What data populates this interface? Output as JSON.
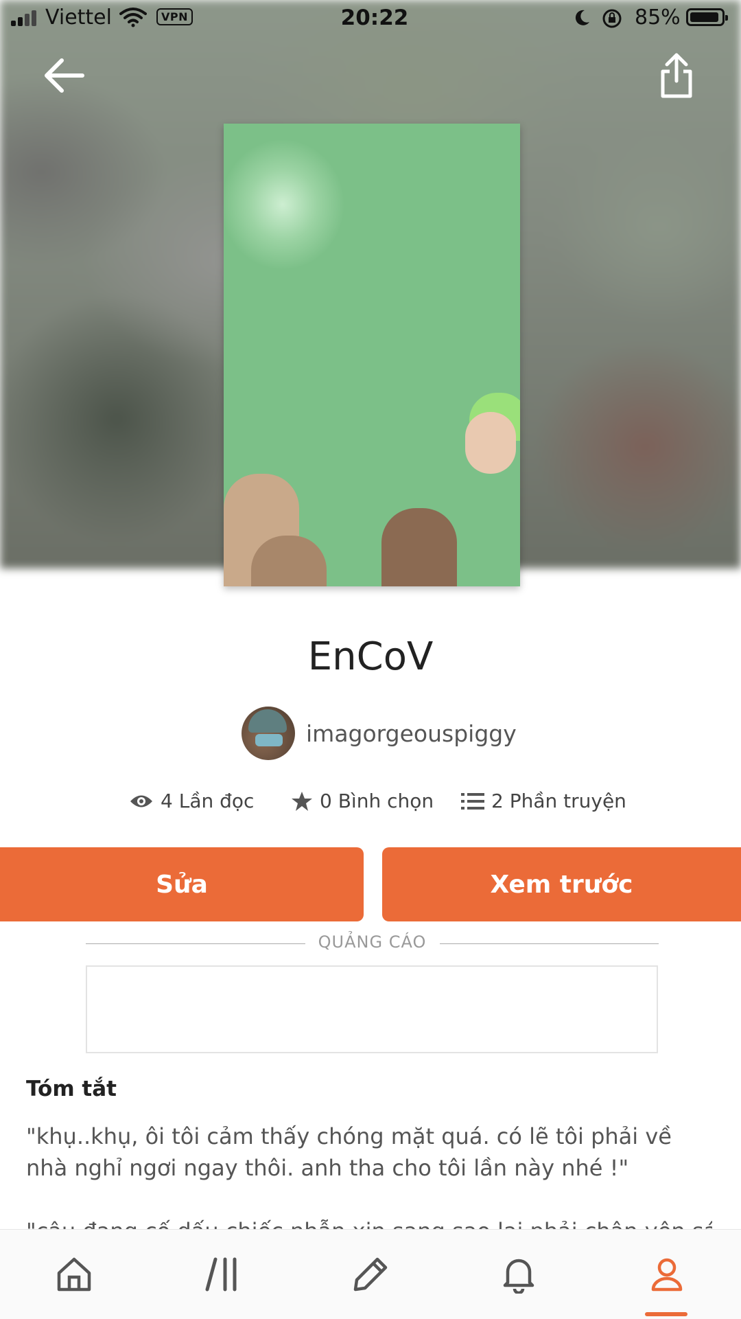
{
  "status_bar": {
    "carrier": "Viettel",
    "vpn": "VPN",
    "time": "20:22",
    "battery": "85%"
  },
  "story": {
    "title": "EnCoV",
    "author": "imagorgeouspiggy"
  },
  "stats": {
    "reads": "4 Lần đọc",
    "votes": "0 Bình chọn",
    "parts": "2 Phần truyện"
  },
  "actions": {
    "edit_label": "Sửa",
    "preview_label": "Xem trước"
  },
  "ad": {
    "label": "QUẢNG CÁO"
  },
  "summary": {
    "heading": "Tóm tắt",
    "paragraph_1": "\"khụ..khụ, ôi tôi cảm thấy chóng mặt quá. có lẽ tôi phải về nhà nghỉ ngơi ngay thôi. anh tha cho tôi lần này nhé !\"",
    "paragraph_2_partial": "\"cậu đang cố dấu chiếc nhẫn xin sang sao lại phải chân yên sách lí"
  },
  "nav": {
    "items": [
      "home-icon",
      "library-icon",
      "write-icon",
      "notifications-icon",
      "profile-icon"
    ],
    "active": "profile-icon"
  },
  "colors": {
    "accent": "#eb6b38"
  }
}
